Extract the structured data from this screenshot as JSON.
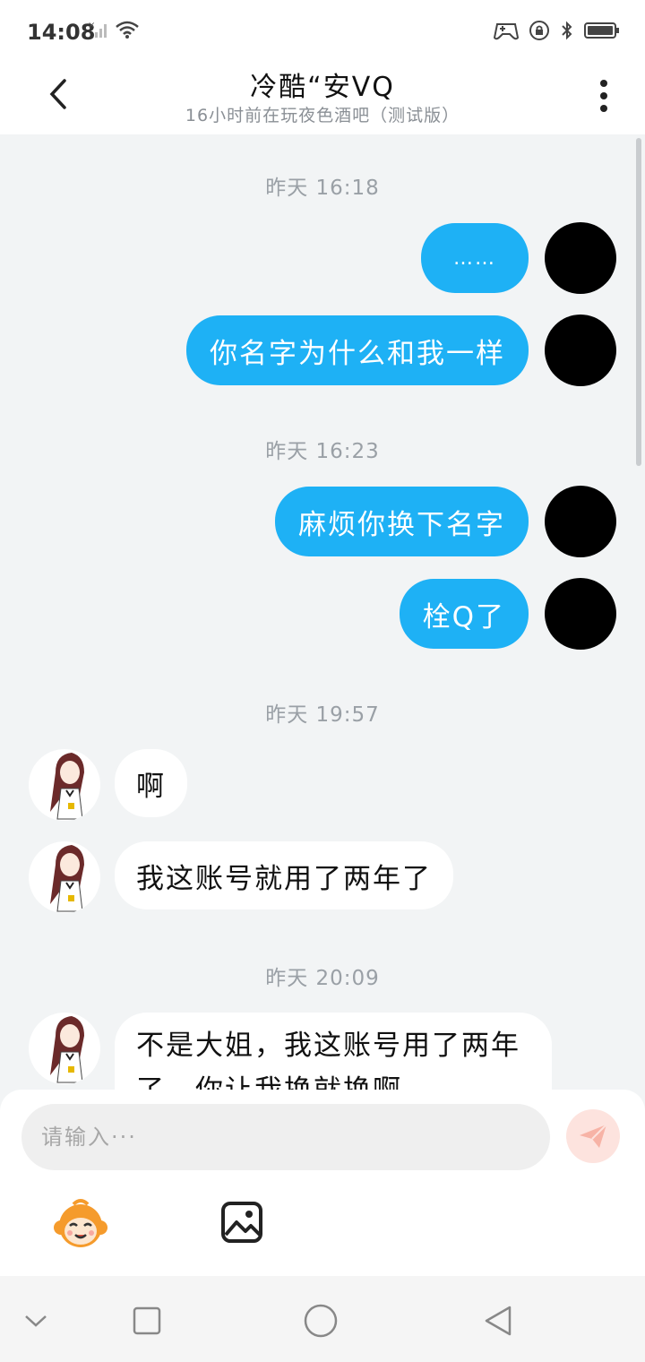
{
  "status_bar": {
    "time": "14:08",
    "icons": [
      "signal-off-icon",
      "wifi-icon",
      "game-controller-icon",
      "lock-rotation-icon",
      "bluetooth-icon",
      "battery-icon"
    ]
  },
  "header": {
    "title": "冷酷“安VQ",
    "subtitle": "16小时前在玩夜色酒吧（测试版）"
  },
  "messages": [
    {
      "type": "timestamp",
      "text": "昨天 16:18"
    },
    {
      "type": "me",
      "text": "……"
    },
    {
      "type": "me",
      "text": "你名字为什么和我一样"
    },
    {
      "type": "timestamp",
      "text": "昨天 16:23"
    },
    {
      "type": "me",
      "text": "麻烦你换下名字"
    },
    {
      "type": "me",
      "text": "栓Q了"
    },
    {
      "type": "timestamp",
      "text": "昨天 19:57"
    },
    {
      "type": "other",
      "text": "啊"
    },
    {
      "type": "other",
      "text": "我这账号就用了两年了"
    },
    {
      "type": "timestamp",
      "text": "昨天 20:09"
    },
    {
      "type": "other",
      "text": "不是大姐，我这账号用了两年了，你让我换就换啊"
    }
  ],
  "composer": {
    "placeholder": "请输入···"
  },
  "colors": {
    "my_bubble": "#1eb1f5",
    "other_bubble": "#ffffff",
    "chat_background": "#f2f4f5",
    "send_button": "#fde3de"
  }
}
